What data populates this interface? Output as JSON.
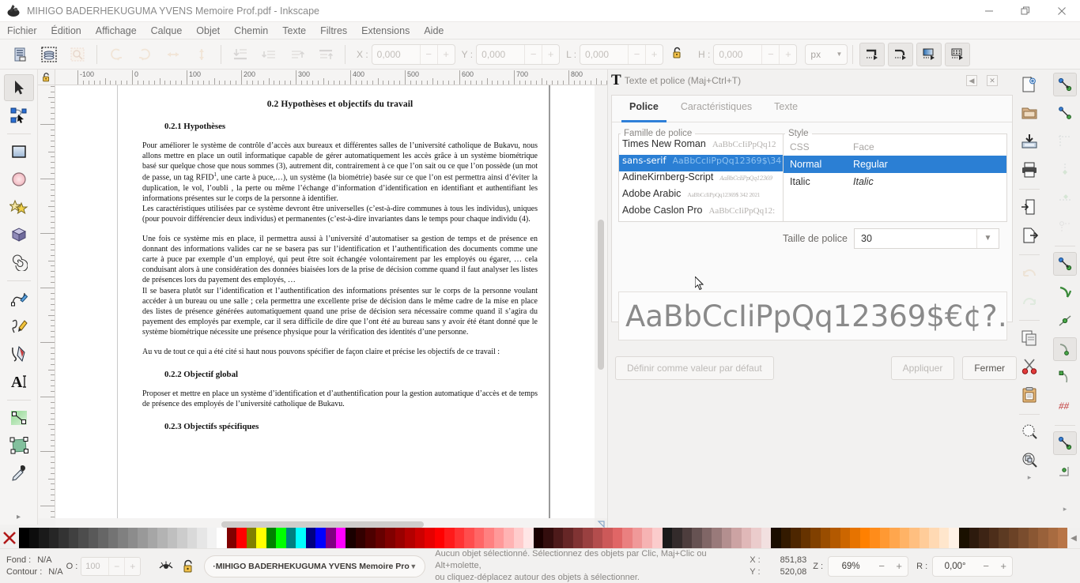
{
  "window": {
    "title": "MIHIGO BADERHEKUGUMA YVENS Memoire Prof.pdf - Inkscape",
    "minimize": "—",
    "maximize": "❐",
    "close": "✕"
  },
  "menubar": {
    "items": [
      {
        "label": "Fichier"
      },
      {
        "label": "Édition"
      },
      {
        "label": "Affichage"
      },
      {
        "label": "Calque"
      },
      {
        "label": "Objet"
      },
      {
        "label": "Chemin"
      },
      {
        "label": "Texte"
      },
      {
        "label": "Filtres"
      },
      {
        "label": "Extensions"
      },
      {
        "label": "Aide"
      }
    ]
  },
  "commandbar": {
    "x_label": "X :",
    "x_value": "0,000",
    "y_label": "Y :",
    "y_value": "0,000",
    "w_label": "L :",
    "w_value": "0,000",
    "h_label": "H :",
    "h_value": "0,000",
    "unit": "px",
    "minus": "−",
    "plus": "+"
  },
  "rulers": {
    "h_labels": [
      "-100",
      "0",
      "100",
      "200",
      "300",
      "400",
      "500",
      "600",
      "700",
      "800"
    ]
  },
  "document": {
    "section_title": "0.2 Hypothèses et objectifs du travail",
    "sub1_title": "0.2.1 Hypothèses",
    "para1": "Pour améliorer  le système de contrôle d’accès aux bureaux et différentes salles de l’université catholique de Bukavu, nous allons mettre en place un outil informatique capable de gérer automatiquement les accès grâce à un système biométrique basé sur quelque chose que nous sommes (3), autrement dit, contrairement à ce que l’on sait ou ce que l’on possède (un mot de passe, un tag RFID",
    "para1_sup": "1",
    "para1b": ", une carte à puce,…), un système (la biométrie) basée sur ce que l’on est permettra ainsi d’éviter la duplication, le vol, l’oubli , la perte ou même l’échange d’information d’identification en identifiant et authentifiant les informations présentes sur le corps de la personne à identifier.",
    "para2": "Les caractéristiques utilisées par ce système devront être universelles (c’est-à-dire communes à tous les individus), uniques (pour pouvoir différencier deux individus) et permanentes (c’est-à-dire invariantes dans le temps pour chaque individu  (4).",
    "para3": "Une fois ce système mis en place, il permettra aussi à l’université d’automatiser sa gestion de temps et de présence en donnant des informations valides car ne se basera pas sur l’identification et l’authentification des documents comme une carte à puce par exemple d’un employé, qui peut être soit échangée volontairement par les employés ou égarer, … cela conduisant alors à une considération des données biaisées lors de la prise de décision comme quand il faut analyser les listes de présences lors du payement des employés, …",
    "para4": "Il se basera plutôt sur l’identification et l’authentification des informations présentes sur le corps de la personne voulant accéder à un bureau ou une salle ; cela permettra une excellente prise de décision dans le même cadre de la mise en place des listes de présence générées automatiquement quand une prise de décision sera nécessaire comme quand il s’agira du payement des employés par exemple, car il sera difficile de dire que l’ont été au bureau sans y avoir été étant donné que le système biométrique nécessite une présence physique pour la vérification des identités d’une personne.",
    "para5": "Au vu de tout ce qui a été cité si haut nous pouvons spécifier de façon claire et précise les objectifs de ce travail :",
    "sub2_title": "0.2.2 Objectif global",
    "para6": "Proposer et mettre en place un système d’identification et d’authentification pour la gestion automatique d’accès et de temps de présence des employés de l’université catholique de Bukavu.",
    "sub3_title": "0.2.3 Objectifs spécifiques"
  },
  "dialog": {
    "panel_title": "Texte et police (Maj+Ctrl+T)",
    "dock_prev": "◀",
    "dock_close": "✕",
    "tabs": [
      {
        "label": "Police",
        "active": true
      },
      {
        "label": "Caractéristiques",
        "active": false
      },
      {
        "label": "Texte",
        "active": false
      }
    ],
    "family_legend": "Famille de police",
    "families": [
      {
        "name": "Times New Roman",
        "preview": "AaBbCcIiPpQq12",
        "selected": false
      },
      {
        "name": "sans-serif",
        "preview": "AaBbCcIiPpQq12369$\\34",
        "selected": true
      },
      {
        "name": "AdineKirnberg-Script",
        "preview": "AaBbCcIiPpQq12369",
        "selected": false
      },
      {
        "name": "Adobe Arabic",
        "preview": "AaBbCcIiPpQq12369$ 342 2021",
        "selected": false
      },
      {
        "name": "Adobe Caslon Pro",
        "preview": "AaBbCcIiPpQq12:",
        "selected": false
      }
    ],
    "style_legend": "Style",
    "style_headers": [
      "CSS",
      "Face"
    ],
    "styles": [
      {
        "css": "Normal",
        "face": "Regular",
        "selected": true
      },
      {
        "css": "Italic",
        "face": "Italic",
        "selected": false
      }
    ],
    "size_label": "Taille de police",
    "size_value": "30",
    "size_caret": "▼",
    "preview_text": "AaBbCcIiPpQq12369$€¢?…",
    "btn_default": "Définir comme valeur par défaut",
    "btn_apply": "Appliquer",
    "btn_close": "Fermer"
  },
  "statusbar": {
    "fill_label": "Fond :",
    "fill_value": "N/A",
    "stroke_label": "Contour :",
    "stroke_value": "N/A",
    "opacity_label": "O :",
    "opacity_value": "100",
    "opacity_minus": "−",
    "opacity_plus": "+",
    "layer_name": "·MIHIGO BADERHEKUGUMA YVENS Memoire Prof",
    "layer_caret": "▼",
    "message_line1": "Aucun objet sélectionné. Sélectionnez des objets par Clic, Maj+Clic ou Alt+molette,",
    "message_line2": "ou cliquez-déplacez autour des objets à sélectionner.",
    "x_label": "X :",
    "x_value": "851,83",
    "y_label": "Y :",
    "y_value": "520,08",
    "zoom_label": "Z :",
    "zoom_value": "69%",
    "zoom_minus": "−",
    "zoom_plus": "+",
    "rot_label": "R :",
    "rot_value": "0,00°",
    "rot_minus": "−",
    "rot_plus": "+"
  },
  "palette": {
    "colors": [
      "#000000",
      "#0d0d0d",
      "#1a1a1a",
      "#262626",
      "#333333",
      "#404040",
      "#4d4d4d",
      "#595959",
      "#666666",
      "#737373",
      "#808080",
      "#8c8c8c",
      "#999999",
      "#a6a6a6",
      "#b3b3b3",
      "#bfbfbf",
      "#cccccc",
      "#d9d9d9",
      "#e6e6e6",
      "#f2f2f2",
      "#ffffff",
      "#800000",
      "#ff0000",
      "#808000",
      "#ffff00",
      "#008000",
      "#00ff00",
      "#008080",
      "#00ffff",
      "#000080",
      "#0000ff",
      "#800080",
      "#ff00ff",
      "#1a0000",
      "#330000",
      "#4d0000",
      "#660000",
      "#800000",
      "#990000",
      "#b30000",
      "#cc0000",
      "#e60000",
      "#ff0000",
      "#ff1a1a",
      "#ff3333",
      "#ff4d4d",
      "#ff6666",
      "#ff8080",
      "#ff9999",
      "#ffb3b3",
      "#ffcccc",
      "#ffe6e6",
      "#1a0000",
      "#330d0d",
      "#4d1a1a",
      "#662626",
      "#803333",
      "#994040",
      "#b34d4d",
      "#cc5959",
      "#e06666",
      "#ea8080",
      "#f09999",
      "#f6b3b3",
      "#fbcccc",
      "#1a1a1a",
      "#332b2b",
      "#4d3d3d",
      "#665252",
      "#806666",
      "#997a7a",
      "#b38f8f",
      "#cca3a3",
      "#e0b8b8",
      "#ebcccc",
      "#f2e0e0",
      "#1a0d00",
      "#331a00",
      "#4d2600",
      "#663300",
      "#804000",
      "#994d00",
      "#b35900",
      "#cc6600",
      "#e67300",
      "#ff8000",
      "#ff8c1a",
      "#ff9933",
      "#ffa64d",
      "#ffb366",
      "#ffbf80",
      "#ffcc99",
      "#ffd9b3",
      "#ffe6cc",
      "#fff2e6",
      "#1a1000",
      "#2d1a0d",
      "#3d2415",
      "#4d2e1a",
      "#5c3a22",
      "#6b4226",
      "#7a4d2e",
      "#8a5733",
      "#99613a",
      "#a86b40",
      "#b87547"
    ],
    "x_tooltip": "Aucune couleur"
  },
  "icons": {
    "toolbox": [
      "selector-tool-icon",
      "node-tool-icon",
      "rectangle-tool-icon",
      "ellipse-tool-icon",
      "star-tool-icon",
      "3dbox-tool-icon",
      "spiral-tool-icon",
      "pencil-tool-icon",
      "calligraphy-tool-icon",
      "bezier-tool-icon",
      "text-tool-icon",
      "gradient-tool-icon",
      "mesh-tool-icon",
      "dropper-tool-icon"
    ]
  }
}
